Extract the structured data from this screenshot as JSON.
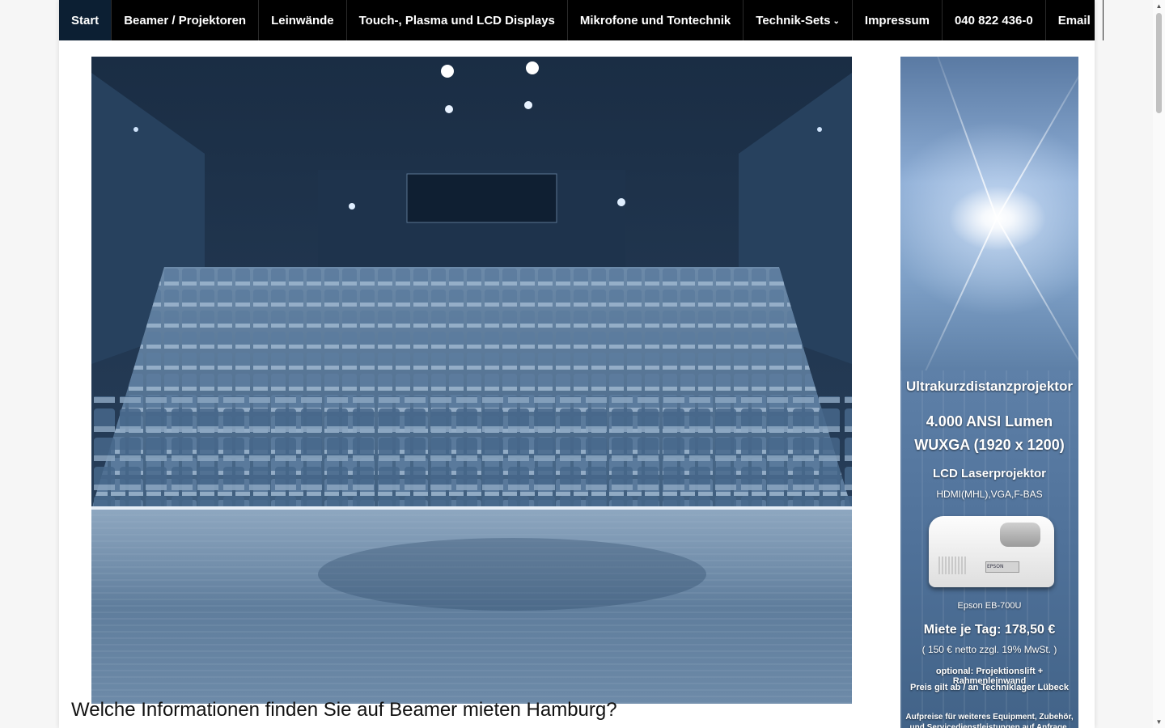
{
  "nav": {
    "items": [
      {
        "label": "Start",
        "active": true
      },
      {
        "label": "Beamer / Projektoren"
      },
      {
        "label": "Leinwände"
      },
      {
        "label": "Touch-, Plasma und LCD Displays"
      },
      {
        "label": "Mikrofone und Tontechnik"
      },
      {
        "label": "Technik-Sets",
        "has_dropdown": true
      },
      {
        "label": "Impressum"
      },
      {
        "label": "040 822 436-0"
      },
      {
        "label": "Email"
      }
    ]
  },
  "hero": {
    "image": "theater-auditorium-seats"
  },
  "ad": {
    "title": "Ultrakurzdistanzprojektor",
    "lumen": "4.000 ANSI Lumen",
    "resolution": "WUXGA (1920 x 1200)",
    "type": "LCD Laserprojektor",
    "ports": "HDMI(MHL),VGA,F-BAS",
    "model": "Epson EB-700U",
    "brand_mark": "EPSON",
    "price": "Miete je  Tag: 178,50 €",
    "price_net": "( 150 € netto zzgl. 19% MwSt. )",
    "option": "optional: Projektionslift + Rahmenleinwand",
    "location": "Preis gilt ab / an Techniklager Lübeck",
    "footnote": "Aufpreise für weiteres Equipment, Zubehör, und Servicedienstleistungen auf Anfrage."
  },
  "main": {
    "heading": "Welche Informationen finden Sie auf Beamer mieten Hamburg?"
  },
  "scrollbar": {
    "up_icon": "▲",
    "down_icon": "▼"
  }
}
